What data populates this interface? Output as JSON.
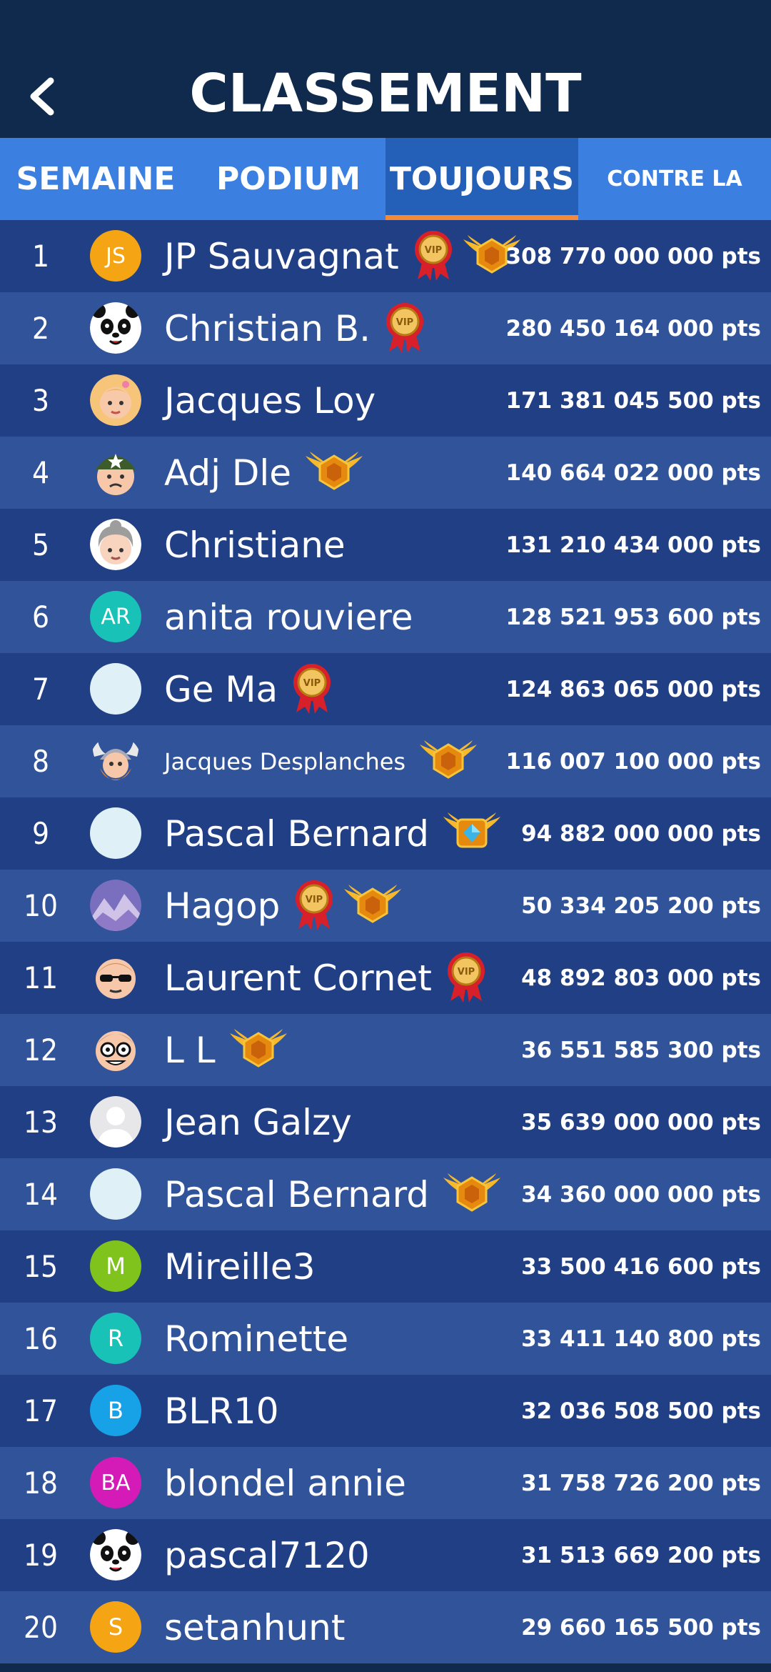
{
  "header": {
    "title": "CLASSEMENT"
  },
  "tabs": [
    {
      "label": "SEMAINE",
      "active": false
    },
    {
      "label": "PODIUM",
      "active": false
    },
    {
      "label": "TOUJOURS",
      "active": true
    },
    {
      "label": "CONTRE LA",
      "active": false
    }
  ],
  "colors": {
    "header_bg": "#0f2a4d",
    "tab_bg": "#3b7fe0",
    "tab_active_bg": "#245fb8",
    "tab_underline": "#f28a3a",
    "row_odd": "#213f85",
    "row_even": "#30539a"
  },
  "rows": [
    {
      "rank": "1",
      "avatar": "initials",
      "initials": "JS",
      "avatar_color": "#f5a413",
      "name": "JP Sauvagnat",
      "badges": [
        "vip-ribbon-icon",
        "gold-wings-icon"
      ],
      "points": "308 770 000 000 pts"
    },
    {
      "rank": "2",
      "avatar": "panda-avatar-icon",
      "name": "Christian B.",
      "badges": [
        "vip-ribbon-icon"
      ],
      "points": "280 450 164 000 pts"
    },
    {
      "rank": "3",
      "avatar": "girl-avatar-icon",
      "name": "Jacques Loy",
      "badges": [],
      "points": "171 381 045 500 pts"
    },
    {
      "rank": "4",
      "avatar": "soldier-avatar-icon",
      "name": "Adj Dle",
      "badges": [
        "gold-wings-icon"
      ],
      "points": "140 664 022 000 pts"
    },
    {
      "rank": "5",
      "avatar": "grandma-avatar-icon",
      "name": "Christiane",
      "badges": [],
      "points": "131 210 434 000 pts"
    },
    {
      "rank": "6",
      "avatar": "initials",
      "initials": "AR",
      "avatar_color": "#19c2b6",
      "name": "anita rouviere",
      "badges": [],
      "points": "128 521 953 600 pts"
    },
    {
      "rank": "7",
      "avatar": "blank-avatar-icon",
      "name": "Ge Ma",
      "badges": [
        "vip-ribbon-icon"
      ],
      "points": "124 863 065 000 pts"
    },
    {
      "rank": "8",
      "avatar": "viking-avatar-icon",
      "name": "Jacques Desplanches",
      "badges": [
        "gold-wings-icon"
      ],
      "points": "116 007 100 000 pts"
    },
    {
      "rank": "9",
      "avatar": "blank-avatar-icon",
      "name": "Pascal Bernard",
      "badges": [
        "gem-wings-icon"
      ],
      "points": "94 882 000 000 pts"
    },
    {
      "rank": "10",
      "avatar": "mountain-avatar-icon",
      "name": "Hagop",
      "badges": [
        "vip-ribbon-icon",
        "gold-wings-icon"
      ],
      "points": "50 334 205 200 pts"
    },
    {
      "rank": "11",
      "avatar": "sunglasses-avatar-icon",
      "name": "Laurent Cornet",
      "badges": [
        "vip-ribbon-icon"
      ],
      "points": "48 892 803 000 pts"
    },
    {
      "rank": "12",
      "avatar": "nerd-avatar-icon",
      "name": "L L",
      "badges": [
        "gold-wings-icon"
      ],
      "points": "36 551 585 300 pts"
    },
    {
      "rank": "13",
      "avatar": "person-silhouette-icon",
      "name": "Jean Galzy",
      "badges": [],
      "points": "35 639 000 000 pts"
    },
    {
      "rank": "14",
      "avatar": "blank-avatar-icon",
      "name": "Pascal Bernard",
      "badges": [
        "gold-wings-icon"
      ],
      "points": "34 360 000 000 pts"
    },
    {
      "rank": "15",
      "avatar": "initials",
      "initials": "M",
      "avatar_color": "#7fc31c",
      "name": "Mireille3",
      "badges": [],
      "points": "33 500 416 600 pts"
    },
    {
      "rank": "16",
      "avatar": "initials",
      "initials": "R",
      "avatar_color": "#19c2b6",
      "name": "Rominette",
      "badges": [],
      "points": "33 411 140 800 pts"
    },
    {
      "rank": "17",
      "avatar": "initials",
      "initials": "B",
      "avatar_color": "#17a2e8",
      "name": "BLR10",
      "badges": [],
      "points": "32 036 508 500 pts"
    },
    {
      "rank": "18",
      "avatar": "initials",
      "initials": "BA",
      "avatar_color": "#d41bb8",
      "name": "blondel annie",
      "badges": [],
      "points": "31 758 726 200 pts"
    },
    {
      "rank": "19",
      "avatar": "panda-avatar-icon",
      "name": "pascal7120",
      "badges": [],
      "points": "31 513 669 200 pts"
    },
    {
      "rank": "20",
      "avatar": "initials",
      "initials": "S",
      "avatar_color": "#f5a413",
      "name": "setanhunt",
      "badges": [],
      "points": "29 660 165 500 pts"
    }
  ]
}
